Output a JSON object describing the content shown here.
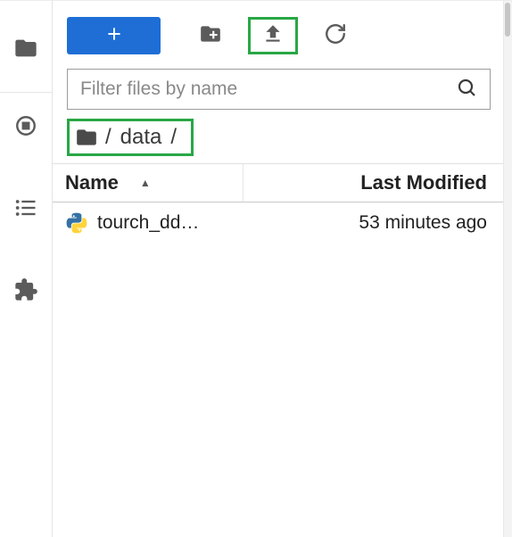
{
  "toolbar": {
    "new_label": "+",
    "new_folder_tip": "New Folder",
    "upload_tip": "Upload Files",
    "refresh_tip": "Refresh File List"
  },
  "filter": {
    "placeholder": "Filter files by name",
    "value": ""
  },
  "breadcrumb": {
    "segments": [
      "/",
      "data",
      "/"
    ]
  },
  "columns": {
    "name": "Name",
    "modified": "Last Modified"
  },
  "files": [
    {
      "name": "tourch_dd…",
      "modified": "53 minutes ago",
      "icon": "python"
    }
  ],
  "highlight": {
    "upload": true,
    "breadcrumb": true
  }
}
